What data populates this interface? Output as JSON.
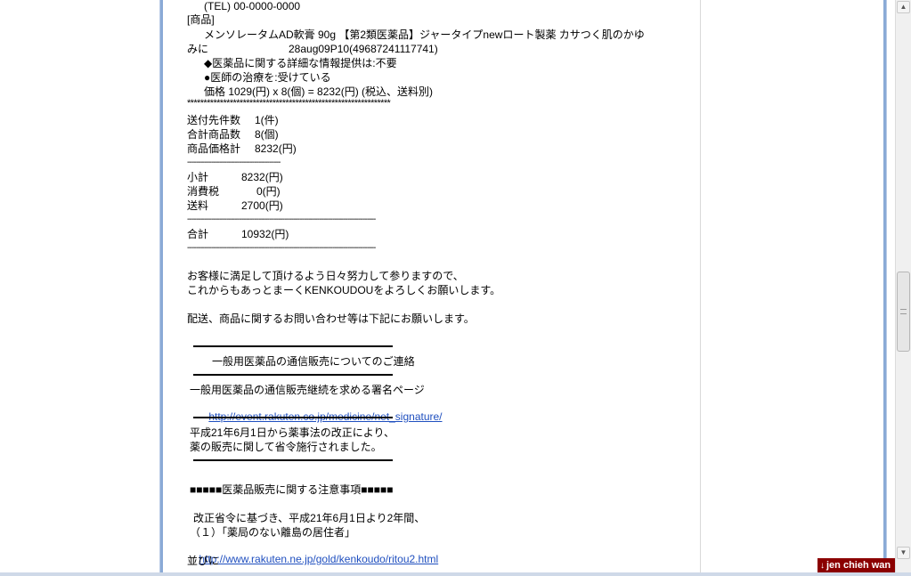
{
  "email": {
    "tel": "(TEL) 00-0000-0000",
    "product_header": "[商品]",
    "product_name": "メンソレータムAD軟膏 90g 【第2類医薬品】ジャータイプnewロート製薬 カサつく肌のかゆ",
    "product_name_cont": "みに",
    "product_code": "28aug09P10(49687241117741)",
    "info_note": "◆医薬品に関する詳細な情報提供は:不要",
    "treatment_note": "●医師の治療を:受けている",
    "price_line": "価格 1029(円) x 8(個) = 8232(円) (税込、送料別)",
    "stars": "**************************************************************",
    "summary": [
      {
        "label": "送付先件数",
        "value": "1(件)"
      },
      {
        "label": "合計商品数",
        "value": "8(個)"
      },
      {
        "label": "商品価格計",
        "value": "8232(円)"
      }
    ],
    "dashes_short": "-------------------------------------------",
    "totals": [
      {
        "label": "小計",
        "value": "8232(円)"
      },
      {
        "label": "消費税",
        "value": "0(円)"
      },
      {
        "label": "送料",
        "value": "2700(円)"
      }
    ],
    "dashes_long": "---------------------------------------------------------------------------------------",
    "grand_total_label": "合計",
    "grand_total_value": "10932(円)",
    "thanks_1": "お客様に満足して頂けるよう日々努力して参りますので、",
    "thanks_2": "これからもあっとまーくKENKOUDOUをよろしくお願いします。",
    "inquiry": "配送、商品に関するお問い合わせ等は下記にお願いします。",
    "notice_title": "一般用医薬品の通信販売についてのご連絡",
    "petition_text": "一般用医薬品の通信販売継続を求める署名ページ",
    "petition_link": "http://event.rakuten.co.jp/medicine/net_signature/",
    "law_1": "平成21年6月1日から薬事法の改正により、",
    "law_2": "薬の販売に関して省令施行されました。",
    "caution_title": "■■■■■医薬品販売に関する注意事項■■■■■",
    "caution_1": "改正省令に基づき、平成21年6月1日より2年間、",
    "caution_2": "（１）「薬局のない離島の居住者」",
    "caution_link": "http://www.rakuten.ne.jp/gold/kenkoudo/ritou2.html",
    "caution_3": "並びに"
  },
  "scrollbar": {
    "up_icon": "▲",
    "down_icon": "▼"
  },
  "user": {
    "name": "jen chieh wan",
    "icon": "↓"
  },
  "colors": {
    "frame": "#8aaad6",
    "link": "#1f4fbf",
    "badge": "#8b0000"
  }
}
